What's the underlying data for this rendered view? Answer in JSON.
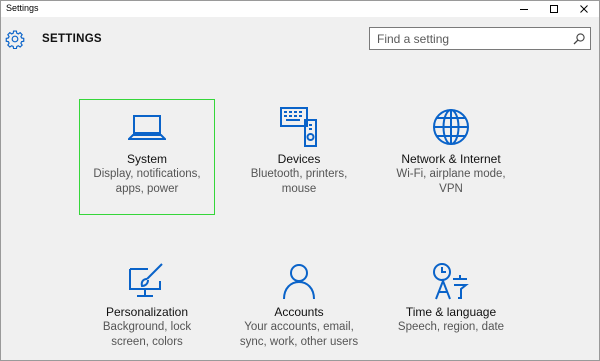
{
  "window": {
    "title": "Settings"
  },
  "header": {
    "title": "SETTINGS"
  },
  "search": {
    "placeholder": "Find a setting"
  },
  "accent_color": "#0a63c9",
  "selection_color": "#35d63a",
  "tiles": [
    {
      "name": "System",
      "desc_line1": "Display, notifications,",
      "desc_line2": "apps, power",
      "icon": "laptop-icon"
    },
    {
      "name": "Devices",
      "desc_line1": "Bluetooth, printers,",
      "desc_line2": "mouse",
      "icon": "devices-icon"
    },
    {
      "name": "Network & Internet",
      "desc_line1": "Wi-Fi, airplane mode,",
      "desc_line2": "VPN",
      "icon": "globe-icon"
    },
    {
      "name": "Personalization",
      "desc_line1": "Background, lock",
      "desc_line2": "screen, colors",
      "icon": "personalization-icon"
    },
    {
      "name": "Accounts",
      "desc_line1": "Your accounts, email,",
      "desc_line2": "sync, work, other users",
      "icon": "person-icon"
    },
    {
      "name": "Time & language",
      "desc_line1": "Speech, region, date",
      "desc_line2": "",
      "icon": "time-language-icon"
    }
  ]
}
